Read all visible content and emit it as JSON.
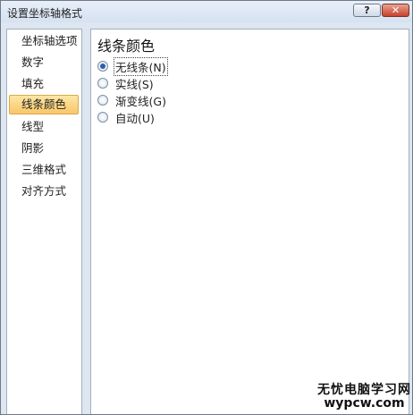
{
  "window": {
    "title": "设置坐标轴格式",
    "help_label": "?",
    "close_label": "✕"
  },
  "nav": {
    "items": [
      {
        "label": "坐标轴选项"
      },
      {
        "label": "数字"
      },
      {
        "label": "填充"
      },
      {
        "label": "线条颜色",
        "selected": true
      },
      {
        "label": "线型"
      },
      {
        "label": "阴影"
      },
      {
        "label": "三维格式"
      },
      {
        "label": "对齐方式"
      }
    ]
  },
  "panel": {
    "title": "线条颜色",
    "options": [
      {
        "label": "无线条(N)",
        "checked": true
      },
      {
        "label": "实线(S)",
        "checked": false
      },
      {
        "label": "渐变线(G)",
        "checked": false
      },
      {
        "label": "自动(U)",
        "checked": false
      }
    ]
  },
  "watermark": {
    "line1": "无忧电脑学习网",
    "line2": "wypcw.com"
  }
}
